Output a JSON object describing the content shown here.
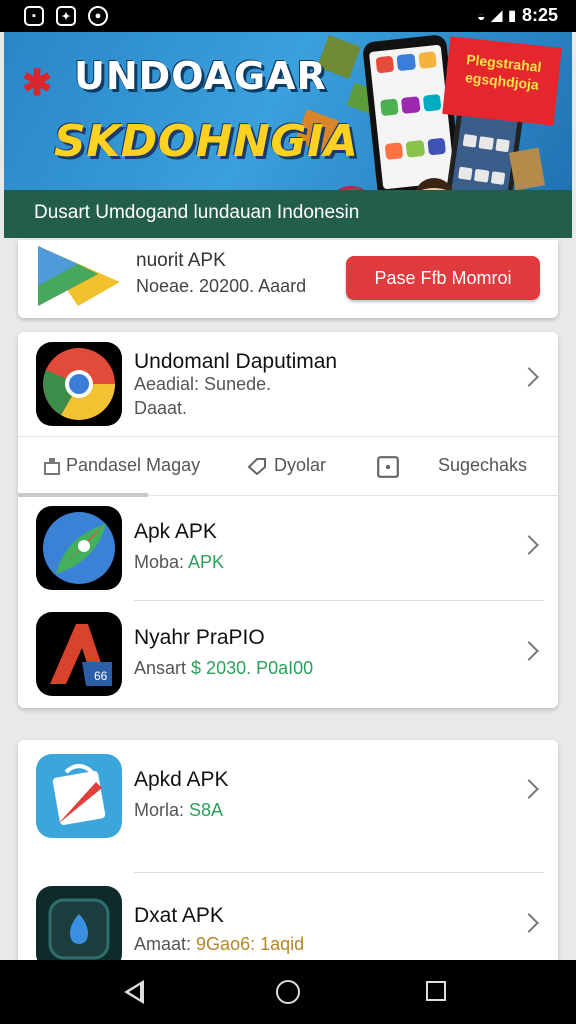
{
  "status_bar": {
    "time": "8:25",
    "left_icons": [
      "notification-icon",
      "game-icon",
      "media-icon"
    ],
    "right_icons": [
      "wifi-icon",
      "signal-icon",
      "battery-icon"
    ]
  },
  "banner": {
    "title_line1": "UNDOAGAR",
    "title_line2": "SKDOHNGIA",
    "tag": "Plegstrahal egsqhdjoja",
    "subtitle": "Dusart Umdogand lundauan Indonesin"
  },
  "featured": {
    "icon": "play-store-icon",
    "title": "nuorit APK",
    "subtitle": "Noeae. 20200. Aaard",
    "button": "Pase Ffb Momroi"
  },
  "top_app": {
    "icon": "chrome-icon",
    "name": "Undomanl Daputiman",
    "line1": "Aeadial: Sunede.",
    "line2": "Daaat."
  },
  "tabs": [
    {
      "label": "Pandasel Magay",
      "icon": "store-icon"
    },
    {
      "label": "Dyolar",
      "icon": "tag-icon"
    },
    {
      "label": "",
      "icon": "square-icon"
    },
    {
      "label": "Sugechaks",
      "icon": ""
    }
  ],
  "apps": [
    {
      "name": "Apk APK",
      "prefix": "Moba:",
      "highlight": "APK",
      "icon": "rocket-app-icon"
    },
    {
      "name": "Nyahr PraPIO",
      "prefix": "Ansart",
      "highlight": "$ 2030. P0aI00",
      "icon": "autocad-icon"
    },
    {
      "name": "Apkd APK",
      "prefix": "Morla:",
      "highlight": "S8A",
      "icon": "bag-app-icon"
    },
    {
      "name": "Dxat APK",
      "prefix": "Amaat:",
      "highlight": "9Gao6: 1aqid",
      "icon": "circle-app-icon"
    }
  ],
  "colors": {
    "accent_red": "#e0393e",
    "price_green": "#2aa05a",
    "banner_footer": "#235e4c"
  }
}
